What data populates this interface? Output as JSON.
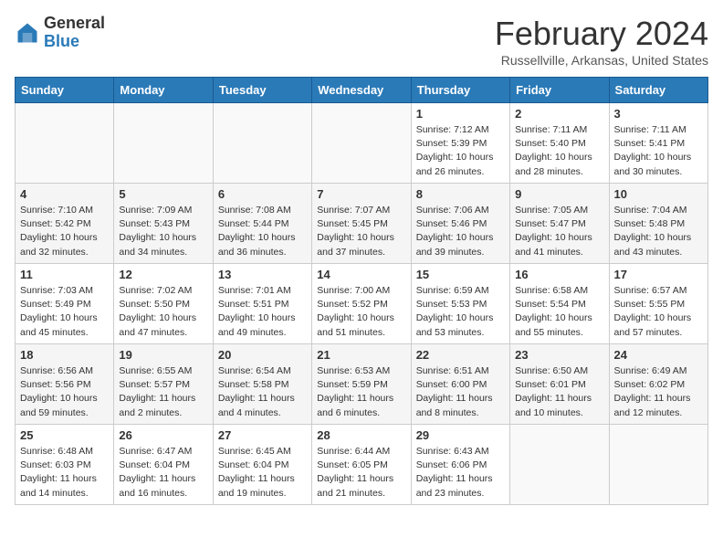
{
  "header": {
    "logo_general": "General",
    "logo_blue": "Blue",
    "title": "February 2024",
    "subtitle": "Russellville, Arkansas, United States"
  },
  "days_of_week": [
    "Sunday",
    "Monday",
    "Tuesday",
    "Wednesday",
    "Thursday",
    "Friday",
    "Saturday"
  ],
  "weeks": [
    [
      {
        "day": "",
        "content": ""
      },
      {
        "day": "",
        "content": ""
      },
      {
        "day": "",
        "content": ""
      },
      {
        "day": "",
        "content": ""
      },
      {
        "day": "1",
        "content": "Sunrise: 7:12 AM\nSunset: 5:39 PM\nDaylight: 10 hours\nand 26 minutes."
      },
      {
        "day": "2",
        "content": "Sunrise: 7:11 AM\nSunset: 5:40 PM\nDaylight: 10 hours\nand 28 minutes."
      },
      {
        "day": "3",
        "content": "Sunrise: 7:11 AM\nSunset: 5:41 PM\nDaylight: 10 hours\nand 30 minutes."
      }
    ],
    [
      {
        "day": "4",
        "content": "Sunrise: 7:10 AM\nSunset: 5:42 PM\nDaylight: 10 hours\nand 32 minutes."
      },
      {
        "day": "5",
        "content": "Sunrise: 7:09 AM\nSunset: 5:43 PM\nDaylight: 10 hours\nand 34 minutes."
      },
      {
        "day": "6",
        "content": "Sunrise: 7:08 AM\nSunset: 5:44 PM\nDaylight: 10 hours\nand 36 minutes."
      },
      {
        "day": "7",
        "content": "Sunrise: 7:07 AM\nSunset: 5:45 PM\nDaylight: 10 hours\nand 37 minutes."
      },
      {
        "day": "8",
        "content": "Sunrise: 7:06 AM\nSunset: 5:46 PM\nDaylight: 10 hours\nand 39 minutes."
      },
      {
        "day": "9",
        "content": "Sunrise: 7:05 AM\nSunset: 5:47 PM\nDaylight: 10 hours\nand 41 minutes."
      },
      {
        "day": "10",
        "content": "Sunrise: 7:04 AM\nSunset: 5:48 PM\nDaylight: 10 hours\nand 43 minutes."
      }
    ],
    [
      {
        "day": "11",
        "content": "Sunrise: 7:03 AM\nSunset: 5:49 PM\nDaylight: 10 hours\nand 45 minutes."
      },
      {
        "day": "12",
        "content": "Sunrise: 7:02 AM\nSunset: 5:50 PM\nDaylight: 10 hours\nand 47 minutes."
      },
      {
        "day": "13",
        "content": "Sunrise: 7:01 AM\nSunset: 5:51 PM\nDaylight: 10 hours\nand 49 minutes."
      },
      {
        "day": "14",
        "content": "Sunrise: 7:00 AM\nSunset: 5:52 PM\nDaylight: 10 hours\nand 51 minutes."
      },
      {
        "day": "15",
        "content": "Sunrise: 6:59 AM\nSunset: 5:53 PM\nDaylight: 10 hours\nand 53 minutes."
      },
      {
        "day": "16",
        "content": "Sunrise: 6:58 AM\nSunset: 5:54 PM\nDaylight: 10 hours\nand 55 minutes."
      },
      {
        "day": "17",
        "content": "Sunrise: 6:57 AM\nSunset: 5:55 PM\nDaylight: 10 hours\nand 57 minutes."
      }
    ],
    [
      {
        "day": "18",
        "content": "Sunrise: 6:56 AM\nSunset: 5:56 PM\nDaylight: 10 hours\nand 59 minutes."
      },
      {
        "day": "19",
        "content": "Sunrise: 6:55 AM\nSunset: 5:57 PM\nDaylight: 11 hours\nand 2 minutes."
      },
      {
        "day": "20",
        "content": "Sunrise: 6:54 AM\nSunset: 5:58 PM\nDaylight: 11 hours\nand 4 minutes."
      },
      {
        "day": "21",
        "content": "Sunrise: 6:53 AM\nSunset: 5:59 PM\nDaylight: 11 hours\nand 6 minutes."
      },
      {
        "day": "22",
        "content": "Sunrise: 6:51 AM\nSunset: 6:00 PM\nDaylight: 11 hours\nand 8 minutes."
      },
      {
        "day": "23",
        "content": "Sunrise: 6:50 AM\nSunset: 6:01 PM\nDaylight: 11 hours\nand 10 minutes."
      },
      {
        "day": "24",
        "content": "Sunrise: 6:49 AM\nSunset: 6:02 PM\nDaylight: 11 hours\nand 12 minutes."
      }
    ],
    [
      {
        "day": "25",
        "content": "Sunrise: 6:48 AM\nSunset: 6:03 PM\nDaylight: 11 hours\nand 14 minutes."
      },
      {
        "day": "26",
        "content": "Sunrise: 6:47 AM\nSunset: 6:04 PM\nDaylight: 11 hours\nand 16 minutes."
      },
      {
        "day": "27",
        "content": "Sunrise: 6:45 AM\nSunset: 6:04 PM\nDaylight: 11 hours\nand 19 minutes."
      },
      {
        "day": "28",
        "content": "Sunrise: 6:44 AM\nSunset: 6:05 PM\nDaylight: 11 hours\nand 21 minutes."
      },
      {
        "day": "29",
        "content": "Sunrise: 6:43 AM\nSunset: 6:06 PM\nDaylight: 11 hours\nand 23 minutes."
      },
      {
        "day": "",
        "content": ""
      },
      {
        "day": "",
        "content": ""
      }
    ]
  ]
}
